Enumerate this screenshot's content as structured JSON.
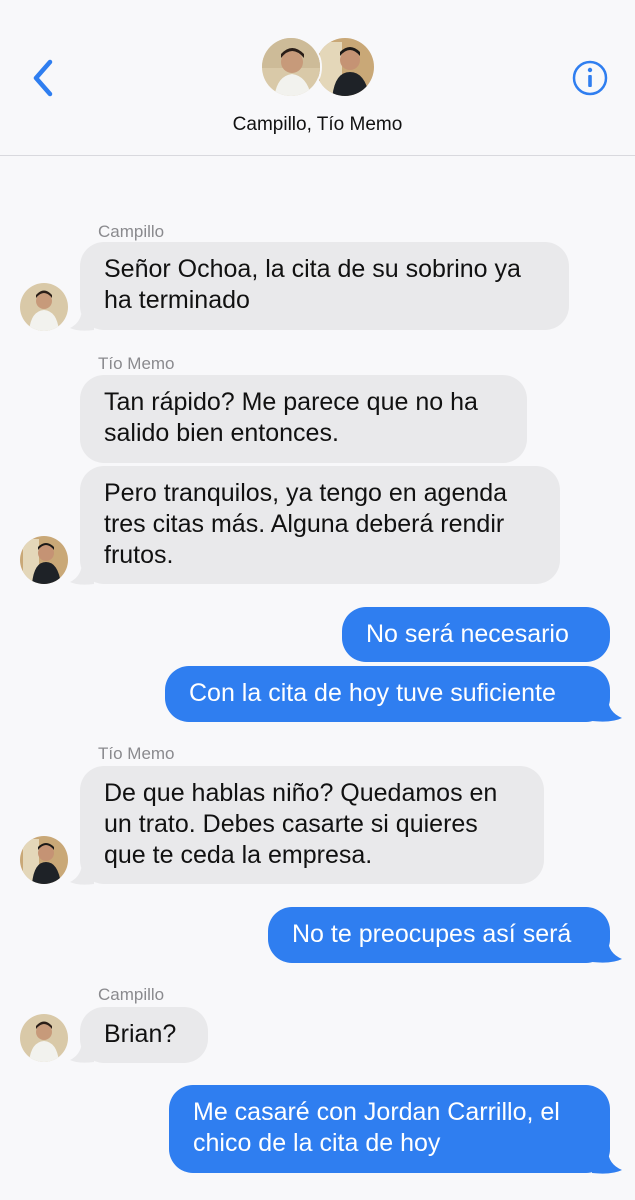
{
  "header": {
    "title": "Campillo, Tío Memo",
    "back_icon": "chevron-left-icon",
    "info_icon": "info-icon",
    "accent": "#2f7ef0"
  },
  "messages": {
    "m1": {
      "sender": "Campillo",
      "text": "Señor Ochoa, la cita de su sobrino ya ha terminado"
    },
    "m2": {
      "sender": "Tío Memo",
      "text": "Tan rápido? Me parece que no ha salido bien entonces."
    },
    "m3": {
      "text": "Pero tranquilos, ya tengo en agenda tres citas más. Alguna deberá rendir frutos."
    },
    "m4": {
      "text": "No será necesario"
    },
    "m5": {
      "text": "Con la cita de hoy tuve suficiente"
    },
    "m6": {
      "sender": "Tío Memo",
      "text": "De que hablas niño? Quedamos en un trato. Debes casarte si quieres que te ceda la empresa."
    },
    "m7": {
      "text": "No te preocupes así será"
    },
    "m8": {
      "sender": "Campillo",
      "text": "Brian?"
    },
    "m9": {
      "text": "Me casaré con Jordan Carrillo, el chico de la cita de hoy"
    }
  },
  "colors": {
    "incoming_bubble": "#e9e9eb",
    "outgoing_bubble": "#2f7ef0"
  }
}
